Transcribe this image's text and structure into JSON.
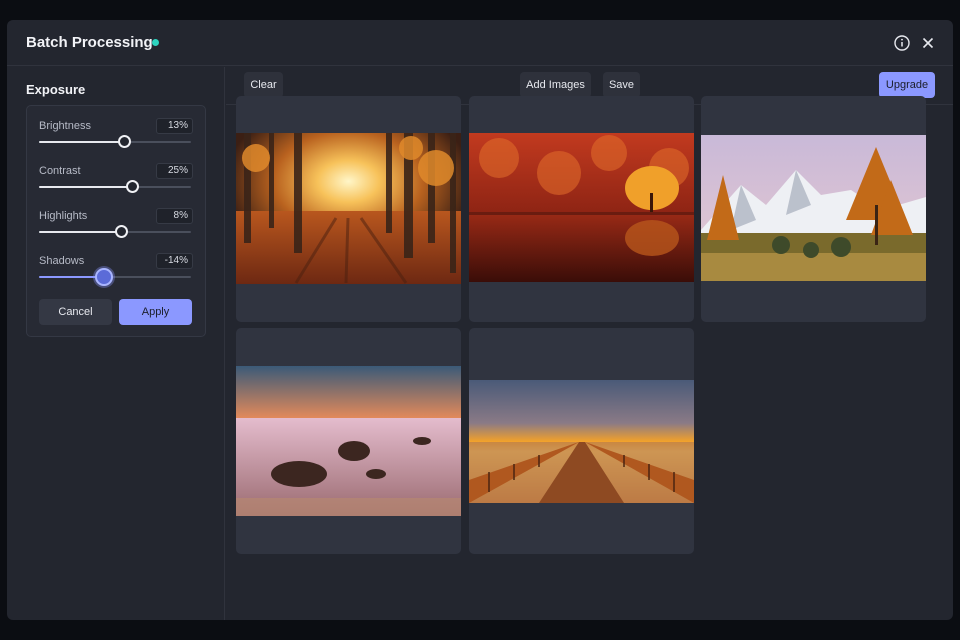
{
  "window": {
    "title": "Batch Processing",
    "status_color": "#2dd4bf"
  },
  "header_icons": [
    "info-icon",
    "close-icon"
  ],
  "sidebar": {
    "title": "Exposure",
    "sliders": [
      {
        "label": "Brightness",
        "value_text": "13%",
        "level": 0.56
      },
      {
        "label": "Contrast",
        "value_text": "25%",
        "level": 0.61
      },
      {
        "label": "Highlights",
        "value_text": "8%",
        "level": 0.54
      },
      {
        "label": "Shadows",
        "value_text": "-14%",
        "level": 0.43,
        "active": true
      }
    ],
    "cancel_label": "Cancel",
    "apply_label": "Apply"
  },
  "toolbar": {
    "clear_label": "Clear",
    "add_images_label": "Add Images",
    "save_label": "Save",
    "upgrade_label": "Upgrade"
  },
  "colors": {
    "accent": "#8b98ff",
    "window_bg": "#23262f",
    "card_bg": "#303440"
  },
  "images": [
    {
      "subject": "autumn forest with sunbeams"
    },
    {
      "subject": "red autumn trees reflected in lake"
    },
    {
      "subject": "orange larch with snowy mountains"
    },
    {
      "subject": "sunset over rocky sea shore"
    },
    {
      "subject": "wooden pier at sunset"
    }
  ]
}
